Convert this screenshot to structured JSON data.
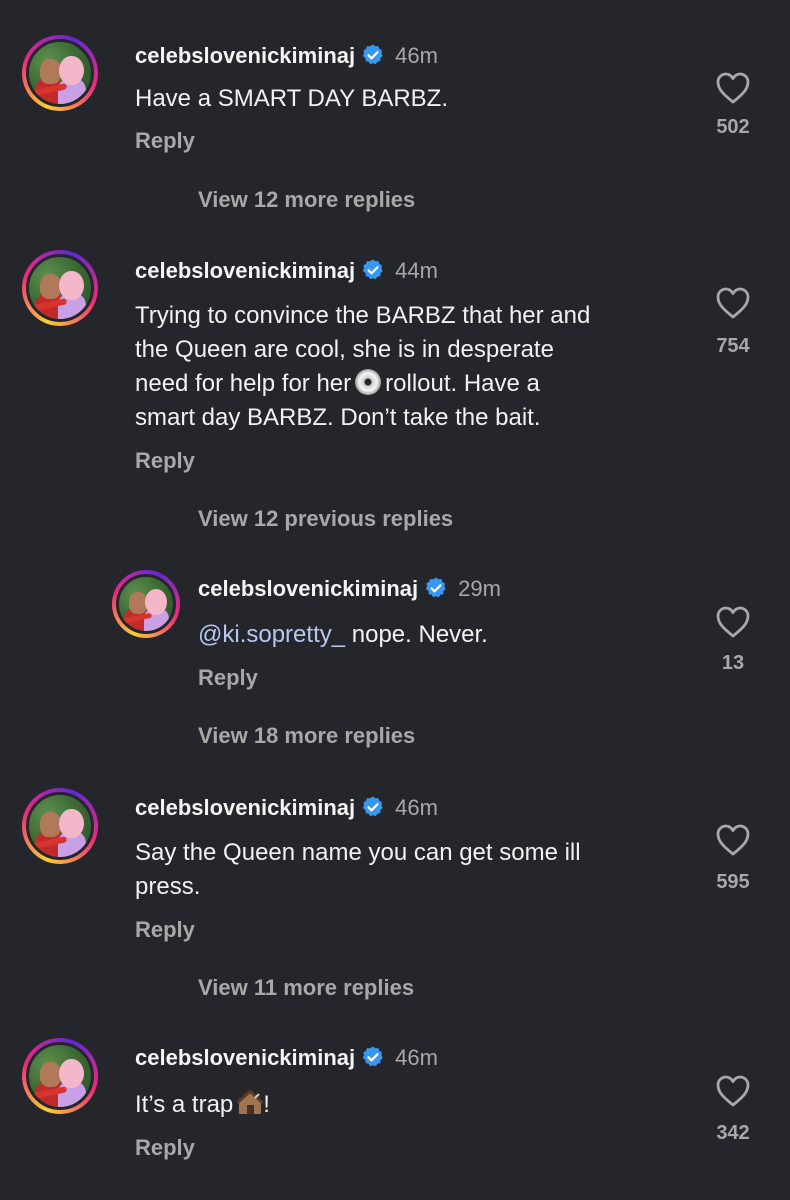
{
  "comments": [
    {
      "username": "celebslovenickiminaj",
      "time": "46m",
      "text": "Have a SMART DAY BARBZ.",
      "reply": "Reply",
      "likes": "502",
      "view_more": "View 12 more replies"
    },
    {
      "username": "celebslovenickiminaj",
      "time": "44m",
      "text_line1": "Trying to convince the BARBZ that her and",
      "text_line2": "the Queen are cool, she is in desperate",
      "text_line3a": "need for help for her",
      "text_line3b": "rollout. Have a",
      "text_line4": "smart day BARBZ. Don’t take the bait.",
      "emoji": "cd-icon",
      "reply": "Reply",
      "likes": "754",
      "view_more": "View 12 previous replies"
    },
    {
      "username": "celebslovenickiminaj",
      "time": "29m",
      "mention": "@ki.sopretty_",
      "text": " nope. Never.",
      "reply": "Reply",
      "likes": "13",
      "view_more": "View 18 more replies"
    },
    {
      "username": "celebslovenickiminaj",
      "time": "46m",
      "text_line1": "Say the Queen name you can get some ill",
      "text_line2": "press.",
      "reply": "Reply",
      "likes": "595",
      "view_more": "View 11 more replies"
    },
    {
      "username": "celebslovenickiminaj",
      "time": "46m",
      "text_a": "It’s a trap",
      "text_b": "!",
      "emoji": "house-icon",
      "reply": "Reply",
      "likes": "342"
    }
  ],
  "colors": {
    "background": "#25262b",
    "verified": "#3897f0",
    "muted": "#a8a8a8",
    "mention": "#b8c7f0"
  }
}
